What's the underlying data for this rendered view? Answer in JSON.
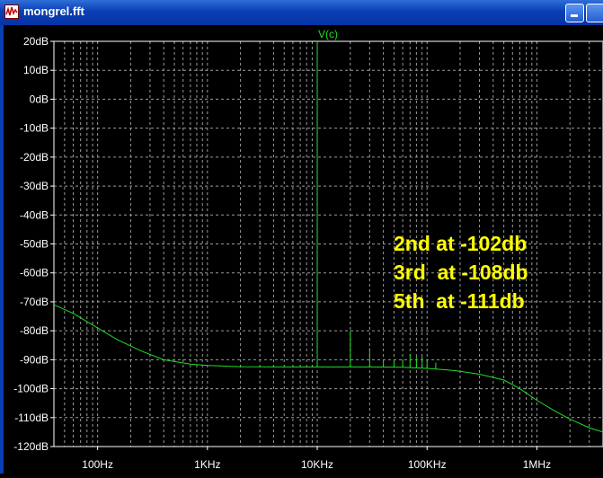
{
  "window": {
    "title": "mongrel.fft",
    "icon": "waveform-icon"
  },
  "annotations": [
    "2nd at -102db",
    "3rd  at -108db",
    "5th  at -111db"
  ],
  "colors": {
    "trace": "#22dd22",
    "annotation": "#ffff00",
    "grid": "#9a9a9a",
    "background": "#000000"
  },
  "chart_data": {
    "type": "line",
    "title": "V(c)",
    "xscale": "log",
    "xlim": [
      40,
      4000000
    ],
    "ylim": [
      -120,
      20
    ],
    "y_ticks": [
      "20dB",
      "10dB",
      "0dB",
      "-10dB",
      "-20dB",
      "-30dB",
      "-40dB",
      "-50dB",
      "-60dB",
      "-70dB",
      "-80dB",
      "-90dB",
      "-100dB",
      "-110dB",
      "-120dB"
    ],
    "x_ticks": [
      {
        "value": 100,
        "label": "100Hz"
      },
      {
        "value": 1000,
        "label": "1KHz"
      },
      {
        "value": 10000,
        "label": "10KHz"
      },
      {
        "value": 100000,
        "label": "100KHz"
      },
      {
        "value": 1000000,
        "label": "1MHz"
      }
    ],
    "grid": true,
    "noise_floor": {
      "x": [
        40,
        60,
        100,
        150,
        250,
        400,
        700,
        1000,
        2000,
        5000,
        10000,
        30000,
        60000,
        100000,
        150000,
        200000,
        300000,
        500000,
        700000,
        1000000,
        1500000,
        2000000,
        3000000,
        4000000
      ],
      "y": [
        -71,
        -74,
        -79,
        -83,
        -87,
        -90,
        -91.5,
        -92,
        -92.4,
        -92.5,
        -92.5,
        -92.5,
        -92.6,
        -93,
        -93.5,
        -94,
        -95,
        -97,
        -100,
        -104,
        -108,
        -110.5,
        -113.5,
        -115
      ]
    },
    "harmonics": {
      "x": [
        10000,
        20000,
        30000,
        40000,
        50000,
        60000,
        70000,
        80000,
        90000,
        100000,
        120000
      ],
      "y": [
        20,
        -80,
        -86,
        -90,
        -90,
        -90,
        -88,
        -89,
        -89,
        -90,
        -91
      ]
    }
  }
}
